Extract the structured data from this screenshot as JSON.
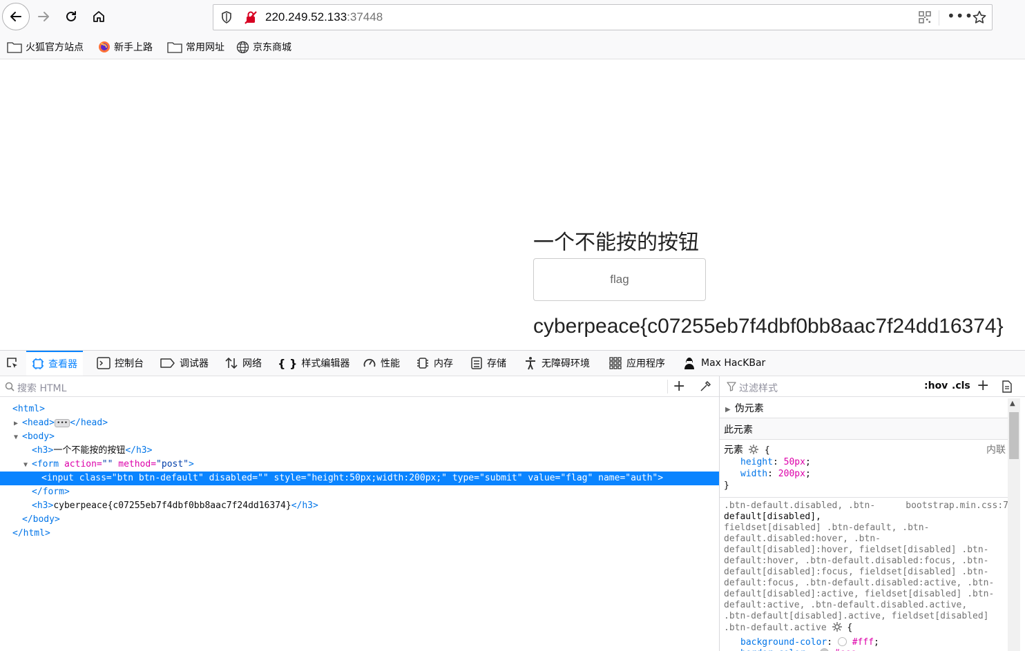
{
  "browser": {
    "url_host": "220.249.52.133",
    "url_port": ":37448",
    "more_label": "•••"
  },
  "bookmarks": [
    {
      "label": "火狐官方站点",
      "icon": "folder-icon"
    },
    {
      "label": "新手上路",
      "icon": "firefox-icon"
    },
    {
      "label": "常用网址",
      "icon": "folder-icon"
    },
    {
      "label": "京东商城",
      "icon": "globe-icon"
    }
  ],
  "page": {
    "heading": "一个不能按的按钮",
    "button_value": "flag",
    "flag_text": "cyberpeace{c07255eb7f4dbf0bb8aac7f24dd16374}"
  },
  "devtools": {
    "tabs": [
      {
        "label": "查看器",
        "icon": "inspector-icon"
      },
      {
        "label": "控制台",
        "icon": "console-icon"
      },
      {
        "label": "调试器",
        "icon": "debugger-icon"
      },
      {
        "label": "网络",
        "icon": "network-icon"
      },
      {
        "label": "样式编辑器",
        "icon": "style-editor-icon"
      },
      {
        "label": "性能",
        "icon": "performance-icon"
      },
      {
        "label": "内存",
        "icon": "memory-icon"
      },
      {
        "label": "存储",
        "icon": "storage-icon"
      },
      {
        "label": "无障碍环境",
        "icon": "accessibility-icon"
      },
      {
        "label": "应用程序",
        "icon": "application-icon"
      },
      {
        "label": "Max HacKBar",
        "icon": "hackbar-icon"
      }
    ],
    "search_placeholder": "搜索 HTML",
    "markup": {
      "html_open": "<html>",
      "head_open": "<head>",
      "head_close": "</head>",
      "body_open": "<body>",
      "h3_open": "<h3>",
      "h3_text": "一个不能按的按钮",
      "h3_close": "</h3>",
      "form_tag": "<form",
      "form_attr1": "action=",
      "form_val1": "\"\"",
      "form_attr2": "method=",
      "form_val2": "\"post\"",
      "form_end": ">",
      "input_line": "<input class=\"btn btn-default\" disabled=\"\" style=\"height:50px;width:200px;\" type=\"submit\" value=\"flag\" name=\"auth\">",
      "form_close": "</form>",
      "h3b_open": "<h3>",
      "h3b_text": "cyberpeace{c07255eb7f4dbf0bb8aac7f24dd16374}",
      "h3b_close": "</h3>",
      "body_close": "</body>",
      "html_close": "</html>"
    },
    "rules": {
      "filter_placeholder": "过滤样式",
      "hov": ":hov",
      "cls": ".cls",
      "pseudo_label": "伪元素",
      "this_element": "此元素",
      "element_selector": "元素",
      "inline_label": "内联",
      "element_props": [
        {
          "name": "height",
          "value": "50px"
        },
        {
          "name": "width",
          "value": "200px"
        }
      ],
      "bs_source": "bootstrap.min.css:7",
      "bs_selector_line1": ".btn-default.disabled, .btn-",
      "bs_selector_line2": "default[disabled],",
      "bs_selector_rest": [
        "fieldset[disabled] .btn-default, .btn-",
        "default.disabled:hover, .btn-",
        "default[disabled]:hover, fieldset[disabled] .btn-",
        "default:hover, .btn-default.disabled:focus, .btn-",
        "default[disabled]:focus, fieldset[disabled] .btn-",
        "default:focus, .btn-default.disabled:active, .btn-",
        "default[disabled]:active, fieldset[disabled] .btn-",
        "default:active, .btn-default.disabled.active,",
        ".btn-default[disabled].active, fieldset[disabled]",
        ".btn-default.active"
      ],
      "bs_props": [
        {
          "name": "background-color",
          "value": "#fff"
        },
        {
          "name": "border-color",
          "value": "#ccc"
        }
      ]
    }
  },
  "colors": {
    "accent": "#0a84ff",
    "tag": "#0074e8",
    "attr": "#dd00a9"
  }
}
